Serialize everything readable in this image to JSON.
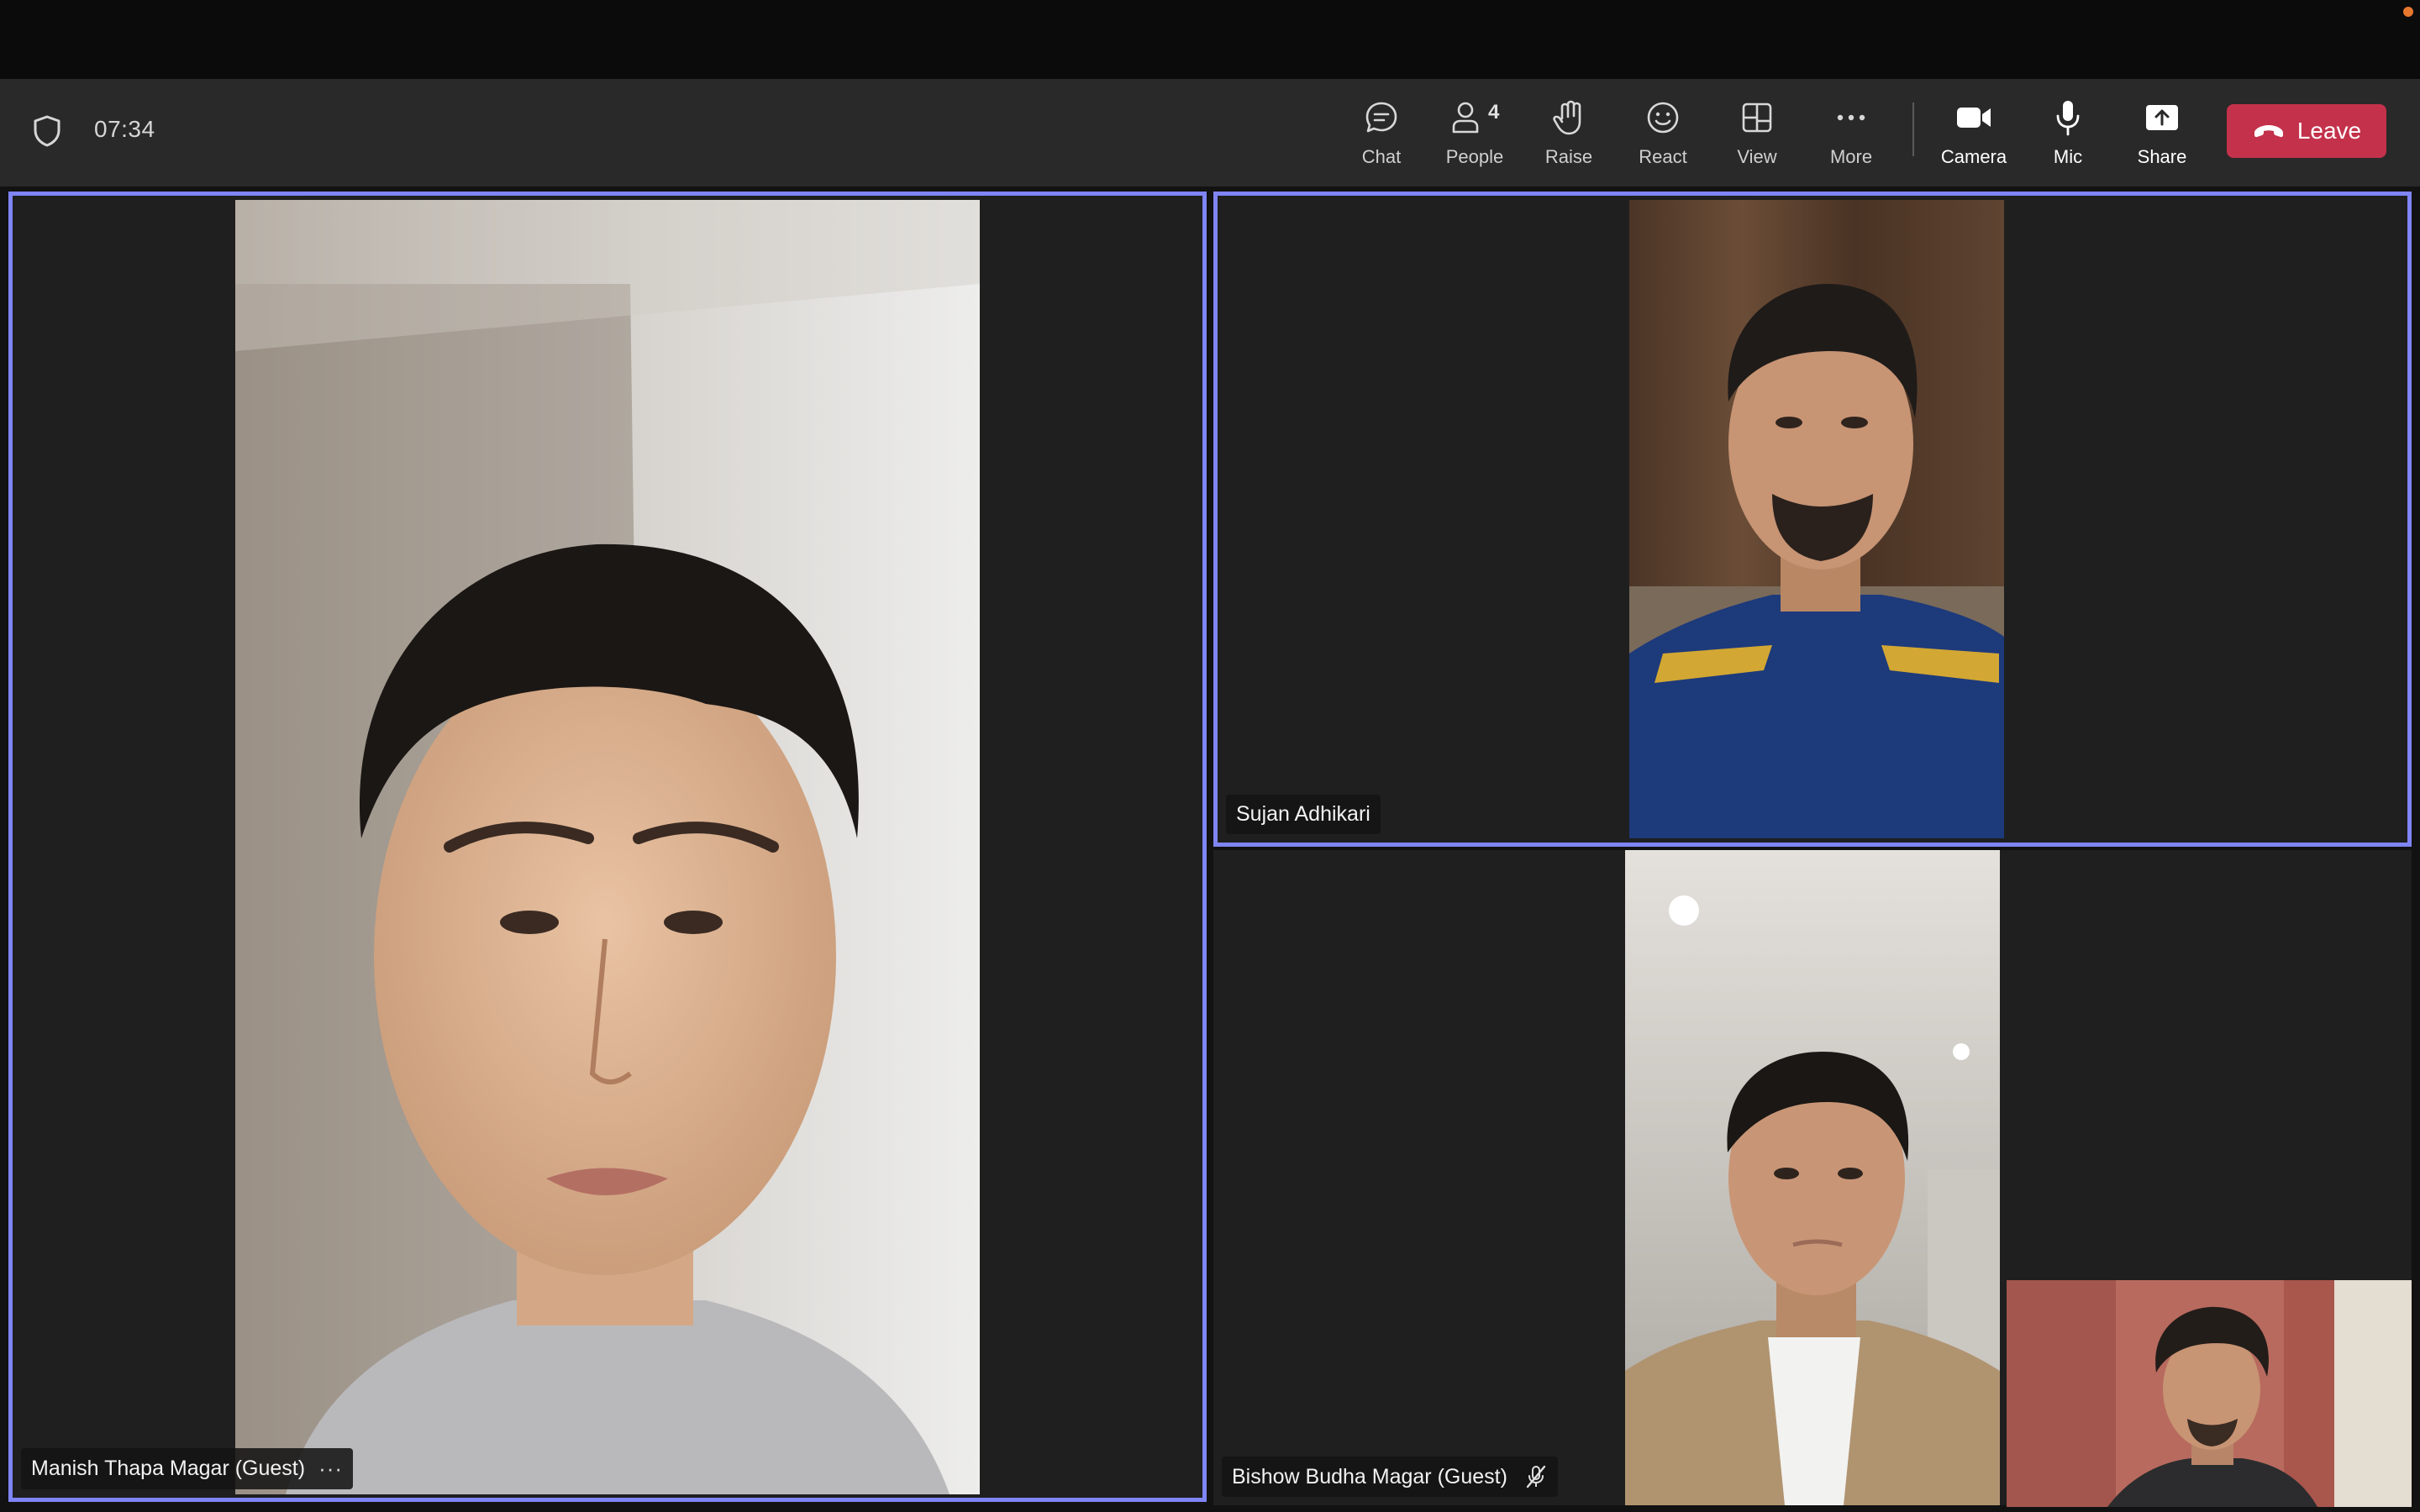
{
  "meeting": {
    "timer": "07:34",
    "people_count": "4"
  },
  "toolbar": {
    "chat_label": "Chat",
    "people_label": "People",
    "raise_label": "Raise",
    "react_label": "React",
    "view_label": "View",
    "more_label": "More",
    "camera_label": "Camera",
    "mic_label": "Mic",
    "share_label": "Share",
    "leave_label": "Leave"
  },
  "participants": [
    {
      "name": "Manish Thapa Magar (Guest)",
      "more": "···"
    },
    {
      "name": "Sujan Adhikari"
    },
    {
      "name": "Bishow Budha Magar (Guest)",
      "muted": true
    }
  ],
  "colors": {
    "accent": "#7f85f5",
    "leave": "#c4314b",
    "toolbar_bg": "#292929",
    "tile_bg": "#1f1f1f"
  },
  "icons": {
    "shield": "shield-icon",
    "chat": "chat-icon",
    "people": "people-icon",
    "raise": "hand-icon",
    "react": "smiley-icon",
    "view": "grid-icon",
    "more": "ellipsis-icon",
    "camera": "camera-icon",
    "mic": "microphone-icon",
    "share": "share-icon",
    "leave": "phone-hangup-icon",
    "muted": "mic-off-icon"
  }
}
